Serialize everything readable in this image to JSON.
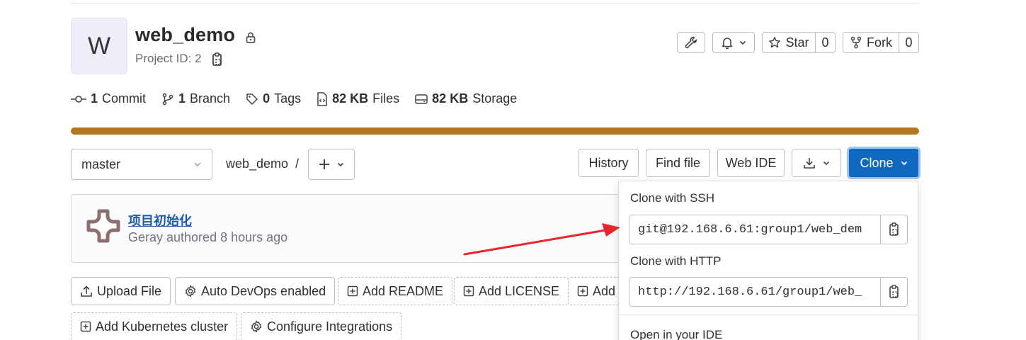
{
  "project": {
    "avatar_letter": "W",
    "name": "web_demo",
    "id_label": "Project ID: 2"
  },
  "header_actions": {
    "star_label": "Star",
    "star_count": "0",
    "fork_label": "Fork",
    "fork_count": "0"
  },
  "stats": [
    {
      "value": "1",
      "label": "Commit"
    },
    {
      "value": "1",
      "label": "Branch"
    },
    {
      "value": "0",
      "label": "Tags"
    },
    {
      "value": "82 KB",
      "label": "Files"
    },
    {
      "value": "82 KB",
      "label": "Storage"
    }
  ],
  "colors": {
    "language_bar": "#b07820",
    "clone_button": "#1068bf",
    "arrow": "#e8262c"
  },
  "toolbar": {
    "branch": "master",
    "path": "web_demo",
    "path_separator": "/",
    "history": "History",
    "find_file": "Find file",
    "web_ide": "Web IDE",
    "clone": "Clone"
  },
  "commit": {
    "title": "项目初始化",
    "meta": "Geray authored 8 hours ago"
  },
  "actions": [
    {
      "label": "Upload File",
      "icon": "upload-icon"
    },
    {
      "label": "Auto DevOps enabled",
      "icon": "gear-icon"
    },
    {
      "label": "Add README",
      "icon": "plus-square-icon"
    },
    {
      "label": "Add LICENSE",
      "icon": "plus-square-icon"
    },
    {
      "label": "Add",
      "icon": "plus-square-icon"
    },
    {
      "label": "Add Kubernetes cluster",
      "icon": "plus-square-icon"
    },
    {
      "label": "Configure Integrations",
      "icon": "gear-icon"
    }
  ],
  "clone_dropdown": {
    "ssh_label": "Clone with SSH",
    "ssh_url": "git@192.168.6.61:group1/web_dem",
    "http_label": "Clone with HTTP",
    "http_url": "http://192.168.6.61/group1/web_",
    "open_ide_label": "Open in your IDE"
  }
}
